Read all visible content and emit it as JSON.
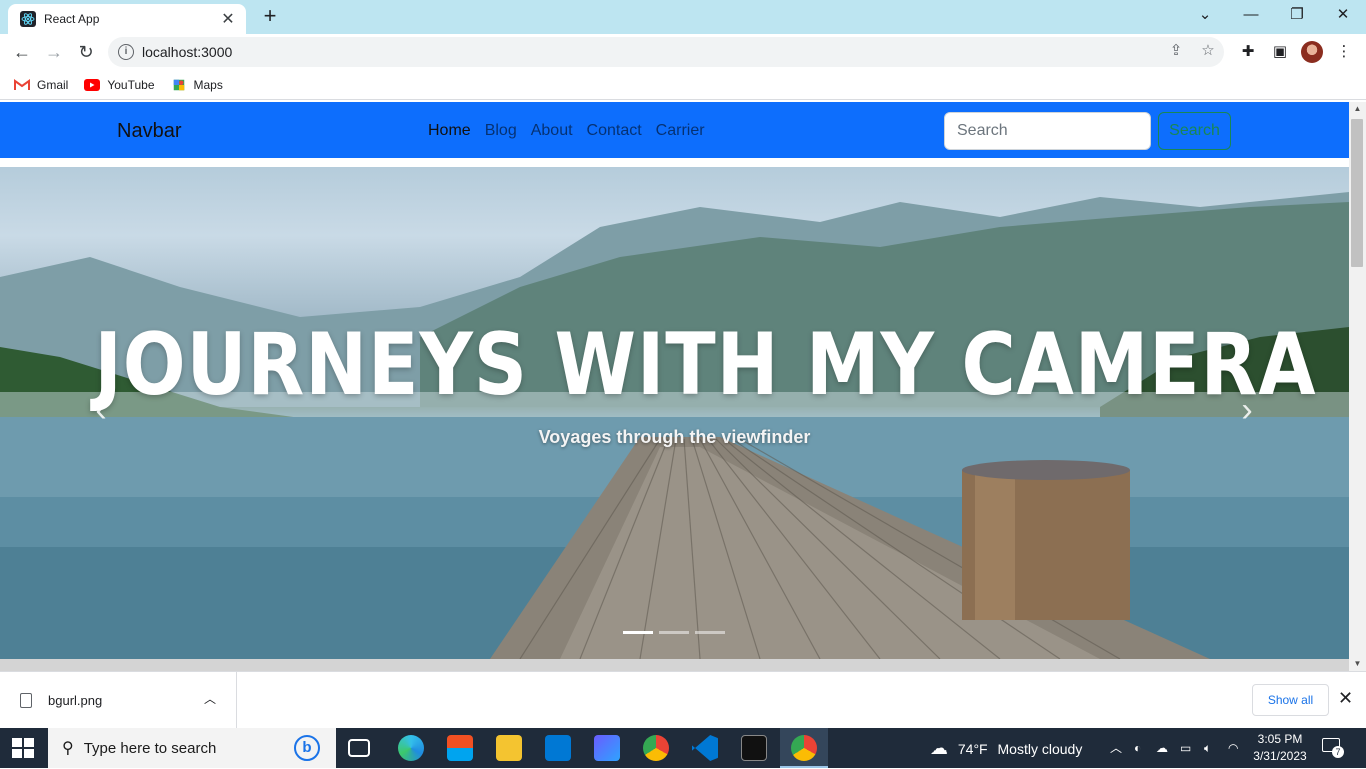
{
  "browser": {
    "tab_title": "React App",
    "url": "localhost:3000",
    "bookmarks": [
      "Gmail",
      "YouTube",
      "Maps"
    ]
  },
  "site": {
    "brand": "Navbar",
    "nav": [
      "Home",
      "Blog",
      "About",
      "Contact",
      "Carrier"
    ],
    "search_placeholder": "Search",
    "search_button": "Search"
  },
  "hero": {
    "title": "JOURNEYS WITH MY CAMERA",
    "subtitle": "Voyages through the viewfinder",
    "slides": 3,
    "active_slide": 1
  },
  "downloads": {
    "file": "bgurl.png",
    "show_all": "Show all"
  },
  "taskbar": {
    "search_placeholder": "Type here to search",
    "weather_temp": "74°F",
    "weather_desc": "Mostly cloudy",
    "time": "3:05 PM",
    "date": "3/31/2023",
    "notifications": "7"
  },
  "colors": {
    "navbar_bg": "#0d6efd",
    "search_button": "#198754",
    "tabstrip": "#bde5f1",
    "taskbar": "#1f2b3a"
  }
}
